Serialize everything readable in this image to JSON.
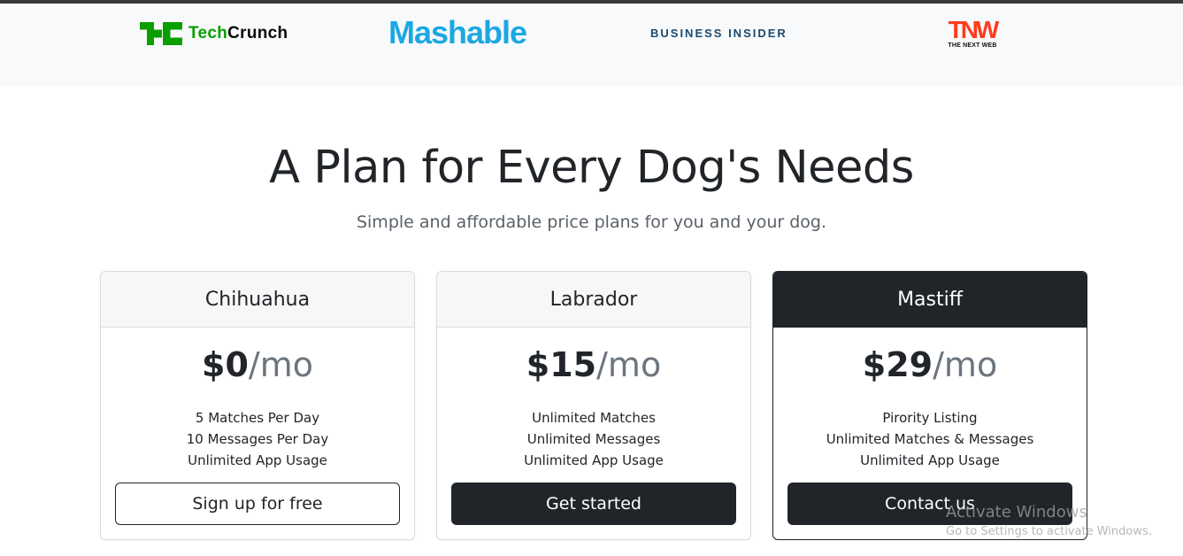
{
  "press": {
    "techcrunch": {
      "prefix": "Tech",
      "suffix": "Crunch",
      "icon": "techcrunch-logo-icon"
    },
    "mashable": "Mashable",
    "business_insider": "BUSINESS INSIDER",
    "tnw": {
      "mark": "TNW",
      "sub": "THE NEXT WEB"
    }
  },
  "pricing": {
    "title": "A Plan for Every Dog's Needs",
    "subtitle": "Simple and affordable price plans for you and your dog.",
    "plans": [
      {
        "name": "Chihuahua",
        "price": "$0",
        "period": "/mo",
        "features": [
          "5 Matches Per Day",
          "10 Messages Per Day",
          "Unlimited App Usage"
        ],
        "cta": "Sign up for free"
      },
      {
        "name": "Labrador",
        "price": "$15",
        "period": "/mo",
        "features": [
          "Unlimited Matches",
          "Unlimited Messages",
          "Unlimited App Usage"
        ],
        "cta": "Get started"
      },
      {
        "name": "Mastiff",
        "price": "$29",
        "period": "/mo",
        "features": [
          "Pirority Listing",
          "Unlimited Matches & Messages",
          "Unlimited App Usage"
        ],
        "cta": "Contact us"
      }
    ]
  },
  "watermark": {
    "title": "Activate Windows",
    "subtitle": "Go to Settings to activate Windows."
  },
  "colors": {
    "dark": "#212529",
    "press_background": "#f8f9fa",
    "techcrunch_green": "#0a9e01",
    "mashable_blue": "#1ba8e3",
    "business_insider_navy": "#1b4a6e",
    "tnw_red": "#ff3c1f"
  }
}
